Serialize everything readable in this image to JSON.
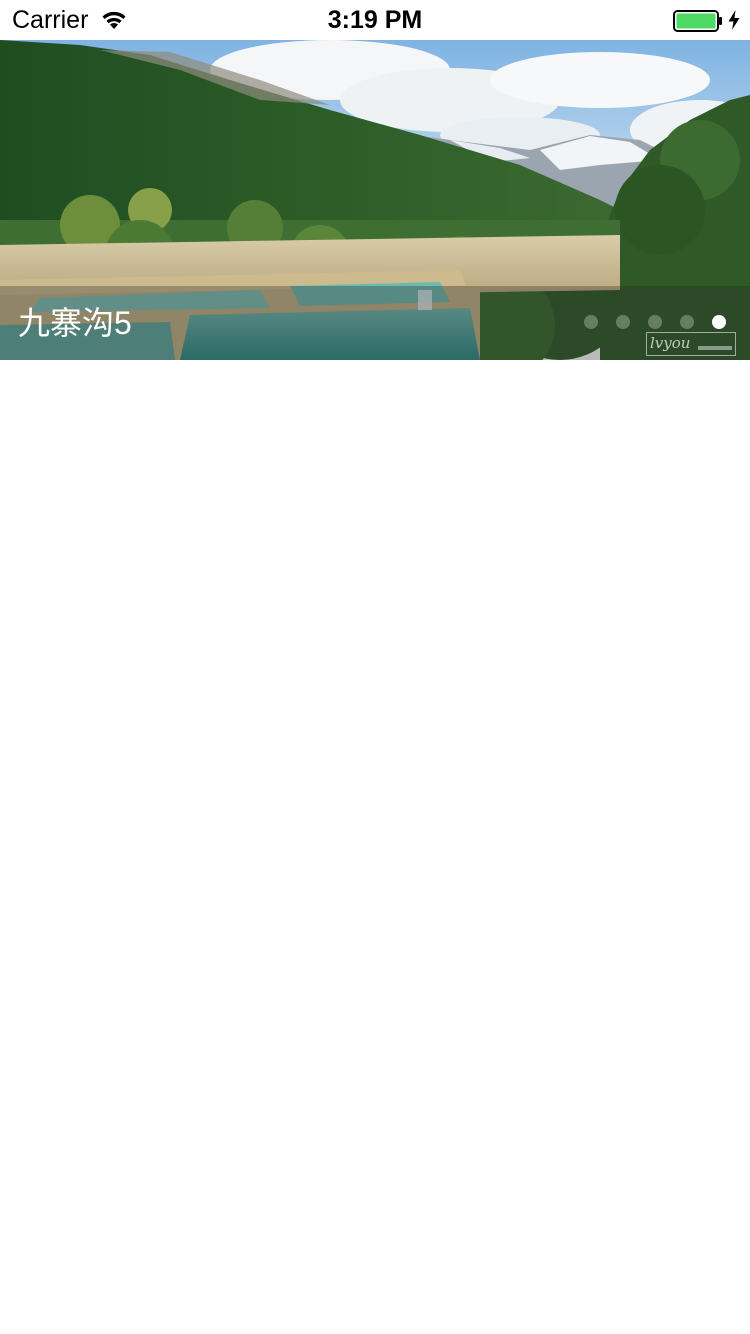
{
  "status_bar": {
    "carrier": "Carrier",
    "time": "3:19 PM",
    "icons": [
      "wifi-icon",
      "battery-icon",
      "charging-icon"
    ],
    "battery_color": "#4cd964"
  },
  "banner": {
    "caption": "九寨沟5",
    "page_count": 5,
    "current_page": 5,
    "watermark": "lvyou"
  }
}
